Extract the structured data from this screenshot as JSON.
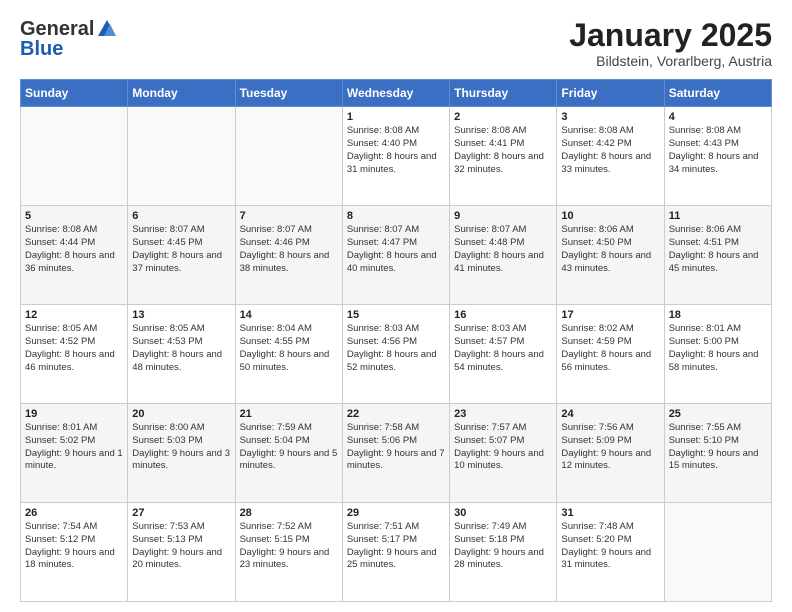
{
  "header": {
    "logo_general": "General",
    "logo_blue": "Blue",
    "month_title": "January 2025",
    "location": "Bildstein, Vorarlberg, Austria"
  },
  "weekdays": [
    "Sunday",
    "Monday",
    "Tuesday",
    "Wednesday",
    "Thursday",
    "Friday",
    "Saturday"
  ],
  "weeks": [
    [
      {
        "day": "",
        "info": ""
      },
      {
        "day": "",
        "info": ""
      },
      {
        "day": "",
        "info": ""
      },
      {
        "day": "1",
        "info": "Sunrise: 8:08 AM\nSunset: 4:40 PM\nDaylight: 8 hours and 31 minutes."
      },
      {
        "day": "2",
        "info": "Sunrise: 8:08 AM\nSunset: 4:41 PM\nDaylight: 8 hours and 32 minutes."
      },
      {
        "day": "3",
        "info": "Sunrise: 8:08 AM\nSunset: 4:42 PM\nDaylight: 8 hours and 33 minutes."
      },
      {
        "day": "4",
        "info": "Sunrise: 8:08 AM\nSunset: 4:43 PM\nDaylight: 8 hours and 34 minutes."
      }
    ],
    [
      {
        "day": "5",
        "info": "Sunrise: 8:08 AM\nSunset: 4:44 PM\nDaylight: 8 hours and 36 minutes."
      },
      {
        "day": "6",
        "info": "Sunrise: 8:07 AM\nSunset: 4:45 PM\nDaylight: 8 hours and 37 minutes."
      },
      {
        "day": "7",
        "info": "Sunrise: 8:07 AM\nSunset: 4:46 PM\nDaylight: 8 hours and 38 minutes."
      },
      {
        "day": "8",
        "info": "Sunrise: 8:07 AM\nSunset: 4:47 PM\nDaylight: 8 hours and 40 minutes."
      },
      {
        "day": "9",
        "info": "Sunrise: 8:07 AM\nSunset: 4:48 PM\nDaylight: 8 hours and 41 minutes."
      },
      {
        "day": "10",
        "info": "Sunrise: 8:06 AM\nSunset: 4:50 PM\nDaylight: 8 hours and 43 minutes."
      },
      {
        "day": "11",
        "info": "Sunrise: 8:06 AM\nSunset: 4:51 PM\nDaylight: 8 hours and 45 minutes."
      }
    ],
    [
      {
        "day": "12",
        "info": "Sunrise: 8:05 AM\nSunset: 4:52 PM\nDaylight: 8 hours and 46 minutes."
      },
      {
        "day": "13",
        "info": "Sunrise: 8:05 AM\nSunset: 4:53 PM\nDaylight: 8 hours and 48 minutes."
      },
      {
        "day": "14",
        "info": "Sunrise: 8:04 AM\nSunset: 4:55 PM\nDaylight: 8 hours and 50 minutes."
      },
      {
        "day": "15",
        "info": "Sunrise: 8:03 AM\nSunset: 4:56 PM\nDaylight: 8 hours and 52 minutes."
      },
      {
        "day": "16",
        "info": "Sunrise: 8:03 AM\nSunset: 4:57 PM\nDaylight: 8 hours and 54 minutes."
      },
      {
        "day": "17",
        "info": "Sunrise: 8:02 AM\nSunset: 4:59 PM\nDaylight: 8 hours and 56 minutes."
      },
      {
        "day": "18",
        "info": "Sunrise: 8:01 AM\nSunset: 5:00 PM\nDaylight: 8 hours and 58 minutes."
      }
    ],
    [
      {
        "day": "19",
        "info": "Sunrise: 8:01 AM\nSunset: 5:02 PM\nDaylight: 9 hours and 1 minute."
      },
      {
        "day": "20",
        "info": "Sunrise: 8:00 AM\nSunset: 5:03 PM\nDaylight: 9 hours and 3 minutes."
      },
      {
        "day": "21",
        "info": "Sunrise: 7:59 AM\nSunset: 5:04 PM\nDaylight: 9 hours and 5 minutes."
      },
      {
        "day": "22",
        "info": "Sunrise: 7:58 AM\nSunset: 5:06 PM\nDaylight: 9 hours and 7 minutes."
      },
      {
        "day": "23",
        "info": "Sunrise: 7:57 AM\nSunset: 5:07 PM\nDaylight: 9 hours and 10 minutes."
      },
      {
        "day": "24",
        "info": "Sunrise: 7:56 AM\nSunset: 5:09 PM\nDaylight: 9 hours and 12 minutes."
      },
      {
        "day": "25",
        "info": "Sunrise: 7:55 AM\nSunset: 5:10 PM\nDaylight: 9 hours and 15 minutes."
      }
    ],
    [
      {
        "day": "26",
        "info": "Sunrise: 7:54 AM\nSunset: 5:12 PM\nDaylight: 9 hours and 18 minutes."
      },
      {
        "day": "27",
        "info": "Sunrise: 7:53 AM\nSunset: 5:13 PM\nDaylight: 9 hours and 20 minutes."
      },
      {
        "day": "28",
        "info": "Sunrise: 7:52 AM\nSunset: 5:15 PM\nDaylight: 9 hours and 23 minutes."
      },
      {
        "day": "29",
        "info": "Sunrise: 7:51 AM\nSunset: 5:17 PM\nDaylight: 9 hours and 25 minutes."
      },
      {
        "day": "30",
        "info": "Sunrise: 7:49 AM\nSunset: 5:18 PM\nDaylight: 9 hours and 28 minutes."
      },
      {
        "day": "31",
        "info": "Sunrise: 7:48 AM\nSunset: 5:20 PM\nDaylight: 9 hours and 31 minutes."
      },
      {
        "day": "",
        "info": ""
      }
    ]
  ]
}
